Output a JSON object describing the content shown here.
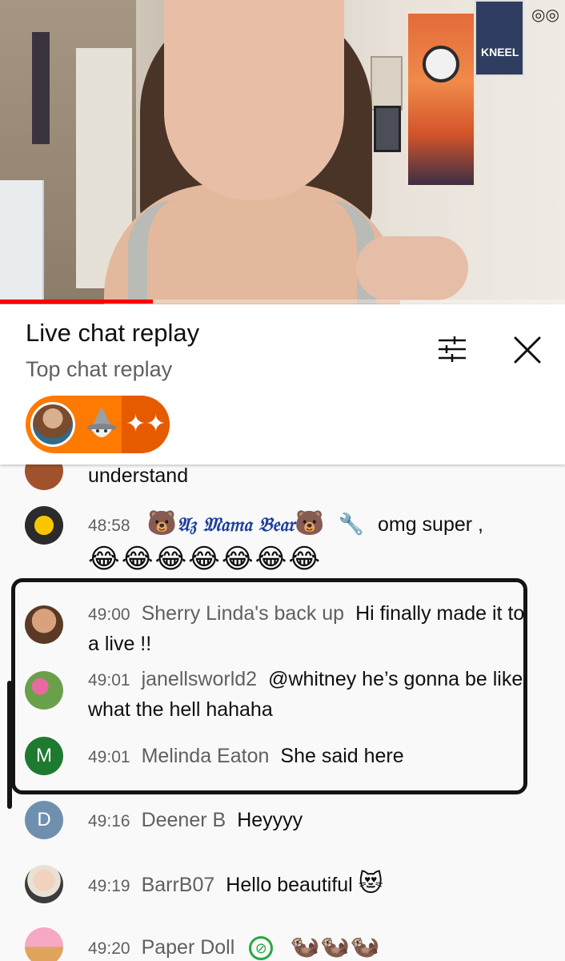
{
  "video": {
    "poster_text": "KNEEL",
    "progress_percent": 27
  },
  "header": {
    "title": "Live chat replay",
    "subtitle": "Top chat replay",
    "filter_icon": "tune-icon",
    "close_icon": "close-icon"
  },
  "reactions": {
    "sparkle": "✦✦"
  },
  "messages": [
    {
      "id": "m0",
      "time": "",
      "author": "",
      "text": "understand"
    },
    {
      "id": "m1",
      "time": "48:58",
      "author_prefix": "🐻",
      "author": "𝔄𝔷 𝔐𝔞𝔪𝔞 𝔅𝔢𝔞𝔯",
      "author_suffix": "🐻",
      "text": "omg super ,",
      "emoji_line": "😂😂😂😂😂😂😂"
    },
    {
      "id": "m2",
      "time": "49:00",
      "author": "Sherry Linda's back up",
      "text": "Hi finally made it to a live !!"
    },
    {
      "id": "m3",
      "time": "49:01",
      "author": "janellsworld2",
      "text": "@whitney he’s gonna be like what the hell hahaha"
    },
    {
      "id": "m4",
      "time": "49:01",
      "author": "Melinda Eaton",
      "text": "She said here",
      "avatar_letter": "M",
      "avatar_color": "#1e7a2e"
    },
    {
      "id": "m5",
      "time": "49:16",
      "author": "Deener B",
      "text": "Heyyyy",
      "avatar_letter": "D",
      "avatar_color": "#6f8faf"
    },
    {
      "id": "m6",
      "time": "49:19",
      "author": "BarrB07",
      "text": "Hello beautiful",
      "emoji": "😻"
    },
    {
      "id": "m7",
      "time": "49:20",
      "author": "Paper Doll",
      "text": "🦦🦦🦦"
    }
  ]
}
